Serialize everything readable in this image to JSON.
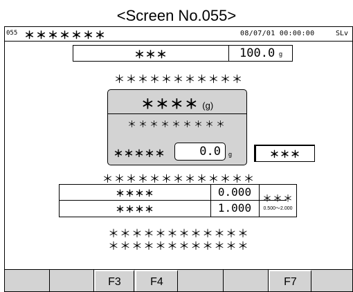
{
  "caption": "<Screen No.055>",
  "status": {
    "screen_no": "055",
    "title": "＊＊＊＊＊＊＊",
    "datetime": "08/07/01 00:00:00",
    "level": "SLv"
  },
  "target": {
    "label": "＊＊＊",
    "value": "100.0",
    "unit": "g"
  },
  "line1": "＊＊＊＊＊＊＊＊＊＊＊",
  "panel": {
    "title": "＊＊＊＊",
    "unit": "(g)",
    "subtitle": "＊＊＊＊＊＊＊＊＊",
    "field_label": "＊＊＊＊＊",
    "field_value": "0.0",
    "field_unit": "g"
  },
  "side_button": "＊＊＊",
  "line2": "＊＊＊＊＊＊＊＊＊＊＊＊＊",
  "table": {
    "rows": [
      {
        "label": "＊＊＊＊",
        "value": "0.000"
      },
      {
        "label": "＊＊＊＊",
        "value": "1.000"
      }
    ],
    "side_label": "＊＊＊",
    "range": "0.500～2.000"
  },
  "line3": "＊＊＊＊＊＊＊＊＊＊＊＊",
  "line4": "＊＊＊＊＊＊＊＊＊＊＊＊",
  "function_keys": [
    "",
    "",
    "F3",
    "F4",
    "",
    "",
    "F7",
    ""
  ]
}
